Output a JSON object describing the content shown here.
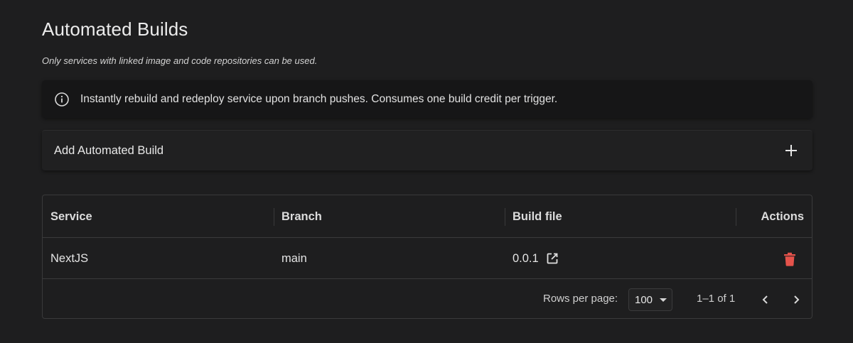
{
  "page": {
    "title": "Automated Builds",
    "subtitle": "Only services with linked image and code repositories can be used."
  },
  "info_banner": {
    "icon": "info-circle-icon",
    "text": "Instantly rebuild and redeploy service upon branch pushes. Consumes one build credit per trigger."
  },
  "add_section": {
    "label": "Add Automated Build",
    "icon": "plus-icon"
  },
  "table": {
    "columns": [
      "Service",
      "Branch",
      "Build file",
      "Actions"
    ],
    "rows": [
      {
        "service": "NextJS",
        "branch": "main",
        "build_file": "0.0.1",
        "build_file_icon": "open-external-icon",
        "action_icon": "trash-icon"
      }
    ],
    "footer": {
      "rows_per_page_label": "Rows per page:",
      "rows_per_page_value": "100",
      "range_text": "1–1 of 1",
      "prev_icon": "chevron-left-icon",
      "next_icon": "chevron-right-icon"
    }
  },
  "colors": {
    "background": "#1e1e1f",
    "banner_background": "#161617",
    "border": "#3a3a3b",
    "delete_red": "#e5534b"
  }
}
